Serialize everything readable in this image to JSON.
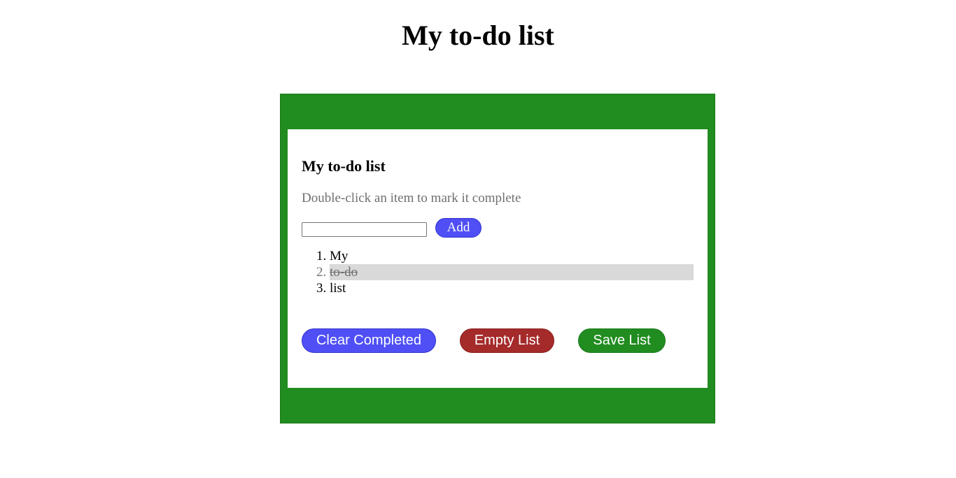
{
  "header": {
    "title": "My to-do list"
  },
  "card": {
    "title": "My to-do list",
    "hint": "Double-click an item to mark it complete",
    "input": {
      "value": "",
      "placeholder": ""
    },
    "add_label": "Add",
    "items": [
      {
        "label": "My",
        "completed": false
      },
      {
        "label": "to-do",
        "completed": true
      },
      {
        "label": "list",
        "completed": false
      }
    ],
    "buttons": {
      "clear_label": "Clear Completed",
      "empty_label": "Empty List",
      "save_label": "Save List"
    }
  },
  "colors": {
    "frame": "#218c20",
    "add_button": "#4f4ff5",
    "clear_button": "#4f4ff5",
    "empty_button": "#a52a2a",
    "save_button": "#218c20",
    "completed_item_bg": "#d9d9d9"
  }
}
